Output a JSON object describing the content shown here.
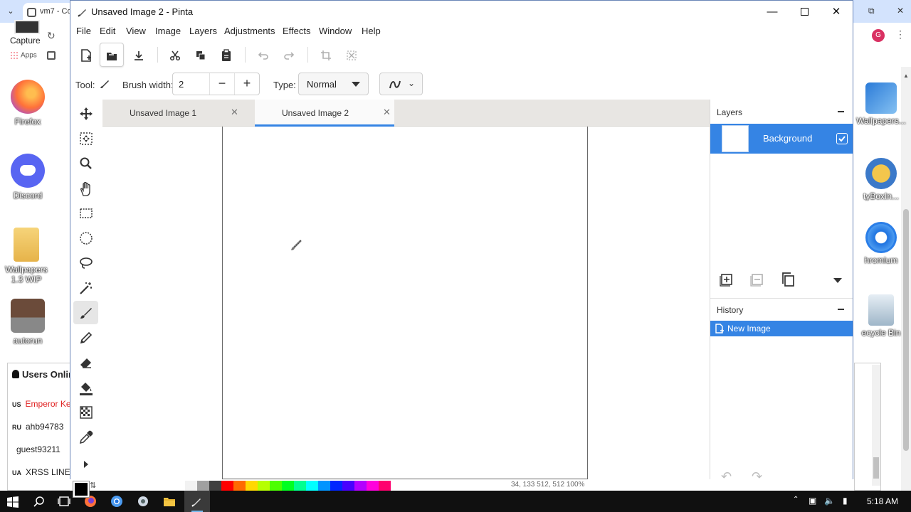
{
  "browser": {
    "tab_title": "vm7 - Co",
    "capture_label": "Capture",
    "apps_label": "Apps",
    "profile_initial": "G"
  },
  "desktop": {
    "left_icons": [
      {
        "label": "Firefox"
      },
      {
        "label": "Discord"
      },
      {
        "label": "Wallpapers 1.3 WIP"
      },
      {
        "label": "autorun"
      }
    ],
    "right_icons": [
      {
        "label": "Wallpapers..."
      },
      {
        "label": "tyBoxIn..."
      },
      {
        "label": "hromium"
      },
      {
        "label": "ecycle Bin"
      }
    ]
  },
  "users_online": {
    "title": "Users Online",
    "rows": [
      {
        "cc": "US",
        "name": "Emperor Ke"
      },
      {
        "cc": "RU",
        "name": "ahb94783"
      },
      {
        "cc": "",
        "name": "guest93211"
      },
      {
        "cc": "UA",
        "name": "XRSS LINEI"
      }
    ]
  },
  "window": {
    "title": "Unsaved Image 2 - Pinta"
  },
  "menu": [
    "File",
    "Edit",
    "View",
    "Image",
    "Layers",
    "Adjustments",
    "Effects",
    "Window",
    "Help"
  ],
  "toolbar2": {
    "tool_label": "Tool:",
    "brush_width_label": "Brush width:",
    "brush_width_value": "2",
    "type_label": "Type:",
    "type_value": "Normal"
  },
  "tabs": [
    {
      "label": "Unsaved Image 1",
      "active": false
    },
    {
      "label": "Unsaved Image 2",
      "active": true
    }
  ],
  "layers": {
    "title": "Layers",
    "items": [
      {
        "name": "Background",
        "visible": true
      }
    ]
  },
  "history": {
    "title": "History",
    "items": [
      {
        "label": "New Image"
      }
    ]
  },
  "palette": {
    "primary": "#000000",
    "colors": [
      "#ffffff",
      "#f2f2f2",
      "#a0a0a0",
      "#404040",
      "#ff0000",
      "#ff6a00",
      "#ffd800",
      "#b6ff00",
      "#4cff00",
      "#00ff21",
      "#00ff90",
      "#00ffff",
      "#0094ff",
      "#0026ff",
      "#4800ff",
      "#b200ff",
      "#ff00dc",
      "#ff006e"
    ]
  },
  "status": {
    "text": "34, 133     512, 512     100%"
  },
  "taskbar": {
    "time": "5:18 AM"
  },
  "colors": {
    "accent": "#3584e4"
  }
}
